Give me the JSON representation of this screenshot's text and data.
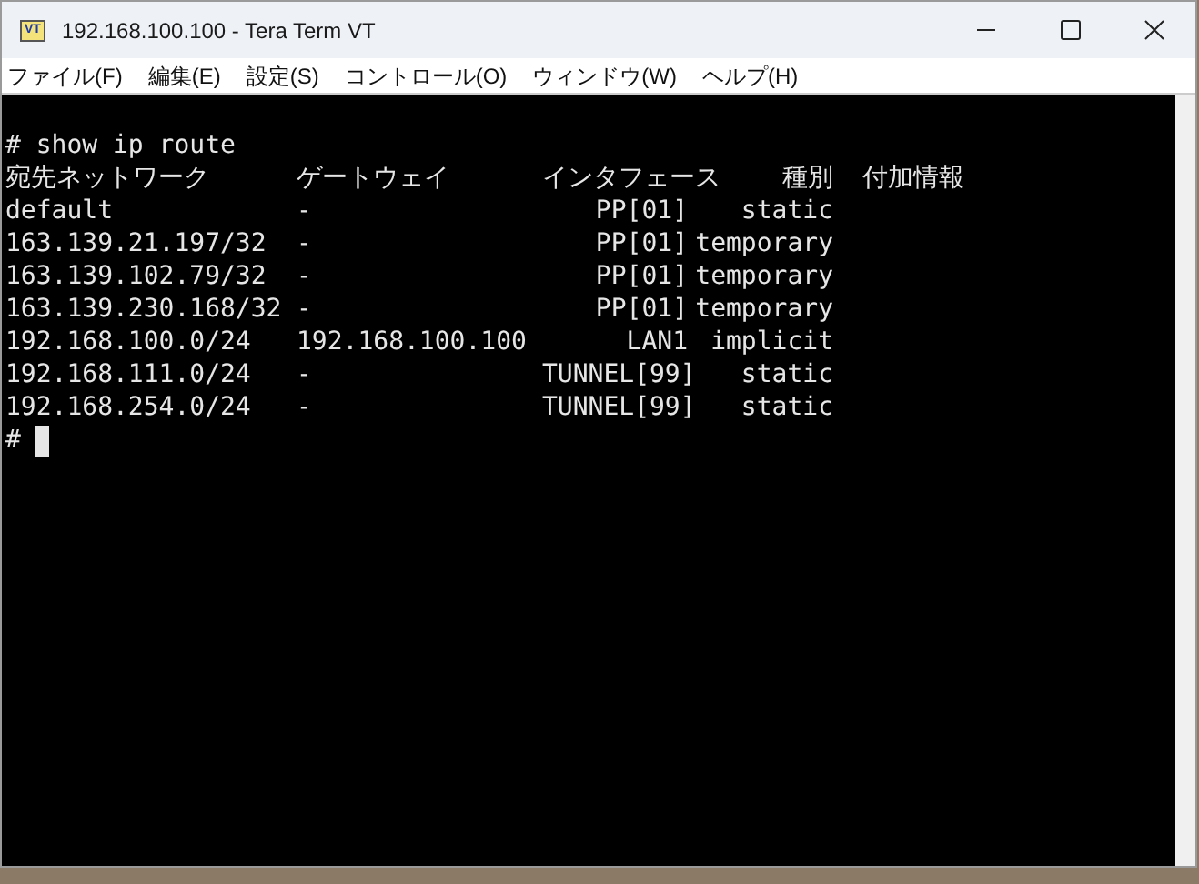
{
  "window": {
    "title": "192.168.100.100 - Tera Term VT",
    "app_icon_text": "VT"
  },
  "menu": [
    "ファイル(F)",
    "編集(E)",
    "設定(S)",
    "コントロール(O)",
    "ウィンドウ(W)",
    "ヘルプ(H)"
  ],
  "terminal": {
    "command": "# show ip route",
    "columns": [
      "宛先ネットワーク",
      "ゲートウェイ",
      "インタフェース",
      "種別",
      "付加情報"
    ],
    "rows": [
      {
        "destination": "default",
        "gateway": "-",
        "interface": "PP[01]",
        "type": "static"
      },
      {
        "destination": "163.139.21.197/32",
        "gateway": "-",
        "interface": "PP[01]",
        "type": "temporary"
      },
      {
        "destination": "163.139.102.79/32",
        "gateway": "-",
        "interface": "PP[01]",
        "type": "temporary"
      },
      {
        "destination": "163.139.230.168/32",
        "gateway": "-",
        "interface": "PP[01]",
        "type": "temporary"
      },
      {
        "destination": "192.168.100.0/24",
        "gateway": "192.168.100.100",
        "interface": "LAN1",
        "type": "implicit"
      },
      {
        "destination": "192.168.111.0/24",
        "gateway": "-",
        "interface": "TUNNEL[99]",
        "type": "static"
      },
      {
        "destination": "192.168.254.0/24",
        "gateway": "-",
        "interface": "TUNNEL[99]",
        "type": "static"
      }
    ],
    "prompt": "#"
  }
}
